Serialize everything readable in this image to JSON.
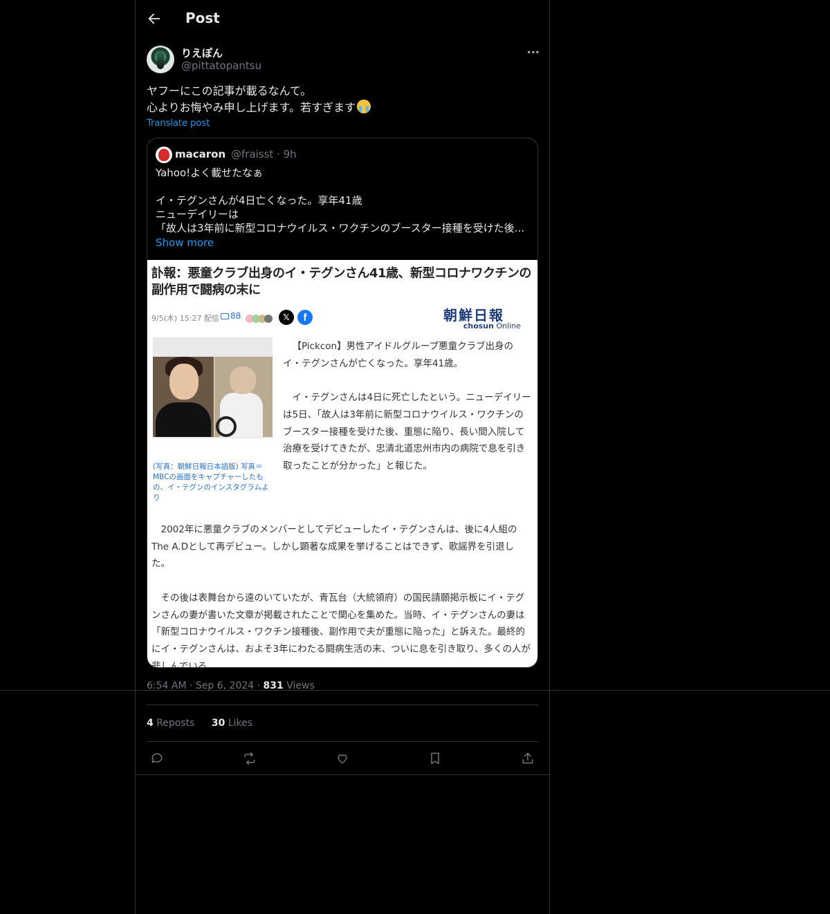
{
  "header": {
    "title": "Post"
  },
  "post": {
    "author_name": "りえぽん",
    "author_handle": "@pittatopantsu",
    "body_lines": [
      "ヤフーにこの記事が載るなんて。",
      "心よりお悔やみ申し上げます。若すぎます"
    ],
    "emoji": "loudly-crying-face",
    "translate_label": "Translate post",
    "time": "6:54 AM",
    "date": "Sep 6, 2024",
    "views_count": "831",
    "views_label": "Views",
    "reposts_count": "4",
    "reposts_label": "Reposts",
    "likes_count": "30",
    "likes_label": "Likes"
  },
  "quote": {
    "name": "macaron",
    "handle": "@fraisst",
    "age": "9h",
    "lines": [
      "Yahoo!よく載せたなぁ",
      "",
      "イ・テグンさんが4日亡くなった。享年41歳",
      "ニューデイリーは",
      "「故人は3年前に新型コロナウイルス・ワクチンのブースター接種を受けた後..."
    ],
    "show_more": "Show more"
  },
  "article": {
    "headline": "訃報：悪童クラブ出身のイ・テグンさん41歳、新型コロナワクチンの副作用で闘病の末に",
    "meta": "9/5(木) 15:27 配信",
    "comments": "88",
    "logo_jp": "朝鮮日報",
    "logo_en_bold": "chosun",
    "logo_en": "Online",
    "caption": "(写真：朝鮮日報日本語版) 写真＝MBCの画面をキャプチャーしたもの、イ・テグンのインスタグラムより",
    "lead_paragraphs": [
      "【Pickcon】男性アイドルグループ悪童クラブ出身のイ・テグンさんが亡くなった。享年41歳。",
      "イ・テグンさんは4日に死亡したという。ニューデイリーは5日、「故人は3年前に新型コロナウイルス・ワクチンのブースター接種を受けた後、重態に陥り、長い間入院して治療を受けてきたが、忠清北道忠州市内の病院で息を引き取ったことが分かった」と報じた。"
    ],
    "paragraphs": [
      "2002年に悪童クラブのメンバーとしてデビューしたイ・テグンさんは、後に4人組のThe A.Dとして再デビュー。しかし顕著な成果を挙げることはできず、歌謡界を引退した。",
      "その後は表舞台から遠のいていたが、青瓦台（大統領府）の国民請願掲示板にイ・テグンさんの妻が書いた文章が掲載されたことで関心を集めた。当時、イ・テグンさんの妻は「新型コロナウイルス・ワクチン接種後、副作用で夫が重態に陥った」と訴えた。最終的にイ・テグンさんは、およそ3年にわたる闘病生活の末、ついに息を引き取り、多くの人が悲しんでいる。"
    ]
  },
  "actions": [
    "reply-icon",
    "repost-icon",
    "like-icon",
    "bookmark-icon",
    "share-icon"
  ],
  "colors": {
    "background": "#000000",
    "text": "#e7e9ea",
    "muted": "#71767b",
    "link": "#1d9bf0",
    "border": "#2f3336"
  }
}
